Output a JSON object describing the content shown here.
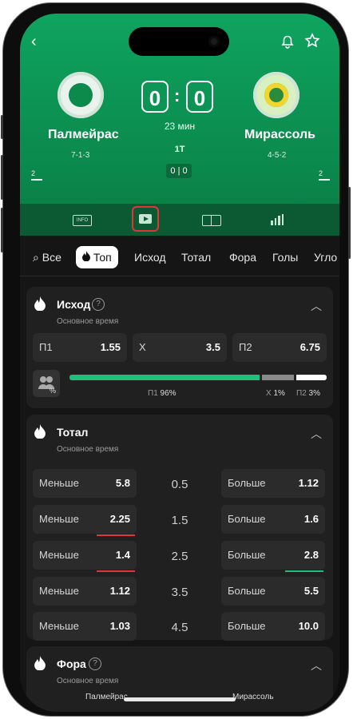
{
  "match": {
    "home_team": "Палмейрас",
    "away_team": "Мирассоль",
    "home_formation": "7-1-3",
    "away_formation": "4-5-2",
    "home_score": "0",
    "away_score": "0",
    "minute": "23 мин",
    "period": "1T",
    "mini_score": "0 | 0",
    "home_corner": "2",
    "away_corner": "2"
  },
  "iconbar": {
    "info_label": "INFO"
  },
  "tabs": [
    "Все",
    "Топ",
    "Исход",
    "Тотал",
    "Фора",
    "Голы",
    "Угло"
  ],
  "outcome": {
    "title": "Исход",
    "subtitle": "Основное время",
    "odds": [
      {
        "label": "П1",
        "value": "1.55"
      },
      {
        "label": "X",
        "value": "3.5"
      },
      {
        "label": "П2",
        "value": "6.75"
      }
    ],
    "stats": {
      "p1_label": "П1",
      "p1_value": "96%",
      "x_label": "X",
      "x_value": "1%",
      "p2_label": "П2",
      "p2_value": "3%",
      "p1_share": 0.96,
      "x_share": 0.01,
      "p2_share": 0.03
    }
  },
  "total": {
    "title": "Тотал",
    "subtitle": "Основное время",
    "rows": [
      {
        "under_label": "Меньше",
        "under": "5.8",
        "line": "0.5",
        "over_label": "Больше",
        "over": "1.12"
      },
      {
        "under_label": "Меньше",
        "under": "2.25",
        "line": "1.5",
        "over_label": "Больше",
        "over": "1.6"
      },
      {
        "under_label": "Меньше",
        "under": "1.4",
        "line": "2.5",
        "over_label": "Больше",
        "over": "2.8"
      },
      {
        "under_label": "Меньше",
        "under": "1.12",
        "line": "3.5",
        "over_label": "Больше",
        "over": "5.5"
      },
      {
        "under_label": "Меньше",
        "under": "1.03",
        "line": "4.5",
        "over_label": "Больше",
        "over": "10.0"
      }
    ]
  },
  "handicap": {
    "title": "Фора",
    "subtitle": "Основное время",
    "home": "Палмейрас",
    "away": "Мирассоль"
  },
  "colors": {
    "brand_green": "#0ea45f",
    "accent_red": "#e0363a",
    "accent_green": "#1fbf7a"
  }
}
